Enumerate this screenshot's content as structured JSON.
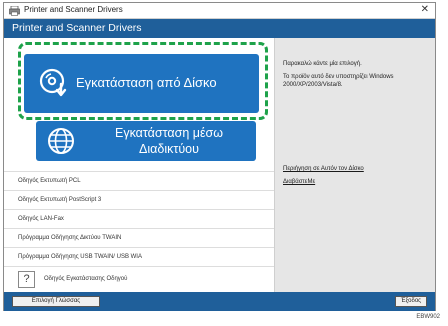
{
  "window": {
    "title": "Printer and Scanner Drivers"
  },
  "header": {
    "title": "Printer and Scanner Drivers"
  },
  "buttons": {
    "install_from_disk": "Εγκατάσταση από Δίσκο",
    "install_from_web": "Εγκατάσταση μέσω Διαδικτύου"
  },
  "drivers": [
    "Οδηγός Εκτυπωτή PCL",
    "Οδηγός Εκτυπωτή PostScript 3",
    "Οδηγός LAN-Fax",
    "Πρόγραμμα Οδήγησης Δικτύου TWAIN",
    "Πρόγραμμα Οδήγησης USB TWAIN/ USB WIA"
  ],
  "guide": {
    "label": "Οδηγός Εγκατάστασης Οδηγού",
    "icon": "?"
  },
  "info": {
    "line1": "Παρακαλώ κάντε μία επιλογή.",
    "line2": "Το προϊόν αυτό δεν υποστηρίζει Windows",
    "line3": "2000/XP/2003/Vista/8."
  },
  "links": {
    "about_disk": "Περιήγηση σε Αυτόν τον Δίσκο",
    "readme": "ΔιαβάστεΜε"
  },
  "footer": {
    "language_button": "Επιλογή Γλώσσας",
    "exit_button": "Έξοδος"
  },
  "image_code": "EBW902",
  "colors": {
    "header": "#1f5f9a",
    "button": "#1f73c0",
    "highlight": "#1ea24a"
  }
}
